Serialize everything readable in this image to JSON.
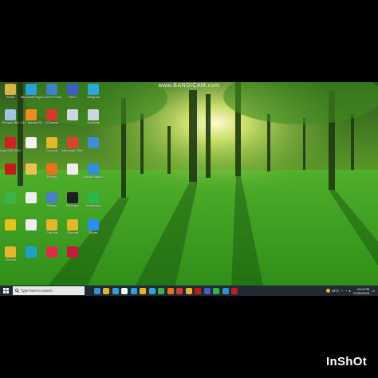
{
  "watermark": "www.BANDICAM.com",
  "desktop_icons": [
    {
      "label": "Home",
      "color": "#d9b24a",
      "icon": "folder-icon"
    },
    {
      "label": "Microsoft Edge",
      "color": "#2f9fd8",
      "icon": "edge-icon"
    },
    {
      "label": "Control Panel",
      "color": "#3f7fc4",
      "icon": "control-panel-icon"
    },
    {
      "label": "Word",
      "color": "#3b5fc4",
      "icon": "word-icon"
    },
    {
      "label": "Telegram",
      "color": "#2ea6da",
      "icon": "telegram-icon"
    },
    {
      "label": "Recycle Bin",
      "color": "#9fc6dd",
      "icon": "recycle-bin-icon"
    },
    {
      "label": "VLC Media Player",
      "color": "#f08c1c",
      "icon": "vlc-icon"
    },
    {
      "label": "CCleaner",
      "color": "#d63a2f",
      "icon": "ccleaner-icon"
    },
    {
      "label": "",
      "color": "#cfd6de",
      "icon": "drive-icon"
    },
    {
      "label": "OneNote",
      "color": "#cfd6de",
      "icon": "app-icon"
    },
    {
      "label": "AutoCAD 2019",
      "color": "#d21f1f",
      "icon": "autocad-icon"
    },
    {
      "label": "",
      "color": "#f2f2f2",
      "icon": "document-icon"
    },
    {
      "label": "Chrome",
      "color": "#e6b52a",
      "icon": "chrome-icon"
    },
    {
      "label": "Microsoft Office",
      "color": "#d9442c",
      "icon": "office-icon"
    },
    {
      "label": "",
      "color": "#3a8fd8",
      "icon": "app-icon"
    },
    {
      "label": "",
      "color": "#c41c1c",
      "icon": "recorder-icon"
    },
    {
      "label": "",
      "color": "#e8c352",
      "icon": "document-icon"
    },
    {
      "label": "Firefox",
      "color": "#e8731c",
      "icon": "firefox-icon"
    },
    {
      "label": "",
      "color": "#eeeeee",
      "icon": "document-icon"
    },
    {
      "label": "Visual Studio Code",
      "color": "#2f8fd8",
      "icon": "vscode-icon"
    },
    {
      "label": "",
      "color": "#3bb54a",
      "icon": "app-icon"
    },
    {
      "label": "",
      "color": "#eeeeee",
      "icon": "document-icon"
    },
    {
      "label": "Python",
      "color": "#4a7fc4",
      "icon": "python-icon"
    },
    {
      "label": "PyCharm",
      "color": "#1f1f1f",
      "icon": "pycharm-icon"
    },
    {
      "label": "WhatsApp",
      "color": "#2bb74a",
      "icon": "whatsapp-icon"
    },
    {
      "label": "",
      "color": "#e8c21c",
      "icon": "app-icon"
    },
    {
      "label": "",
      "color": "#eeeeee",
      "icon": "document-icon"
    },
    {
      "label": "Chrome",
      "color": "#e6b52a",
      "icon": "chrome-icon"
    },
    {
      "label": "Chrome",
      "color": "#e6b52a",
      "icon": "chrome-icon"
    },
    {
      "label": "Zoom",
      "color": "#2d8cf0",
      "icon": "zoom-icon"
    },
    {
      "label": "Chrome",
      "color": "#e6b52a",
      "icon": "chrome-icon"
    },
    {
      "label": "",
      "color": "#1fa0c8",
      "icon": "app-icon"
    },
    {
      "label": "",
      "color": "#e02a4a",
      "icon": "app-icon"
    },
    {
      "label": "",
      "color": "#c41c3a",
      "icon": "app-icon"
    }
  ],
  "taskbar": {
    "search_placeholder": "Type here to search",
    "apps": [
      {
        "color": "#3a8fd8",
        "icon": "task-view-icon"
      },
      {
        "color": "#e6b52a",
        "icon": "file-explorer-icon"
      },
      {
        "color": "#2f9fd8",
        "icon": "edge-icon"
      },
      {
        "color": "#ffffff",
        "icon": "store-icon"
      },
      {
        "color": "#2f9fd8",
        "icon": "mail-icon"
      },
      {
        "color": "#e6b52a",
        "icon": "folder-icon"
      },
      {
        "color": "#2ea6da",
        "icon": "app-icon"
      },
      {
        "color": "#3bb54a",
        "icon": "app-icon"
      },
      {
        "color": "#e8731c",
        "icon": "firefox-icon"
      },
      {
        "color": "#d63a2f",
        "icon": "app-icon"
      },
      {
        "color": "#e6b52a",
        "icon": "chrome-icon"
      },
      {
        "color": "#c41c1c",
        "icon": "app-icon"
      },
      {
        "color": "#3b5fc4",
        "icon": "word-icon"
      },
      {
        "color": "#2bb74a",
        "icon": "whatsapp-icon"
      },
      {
        "color": "#2f8fd8",
        "icon": "vscode-icon"
      },
      {
        "color": "#c41c1c",
        "icon": "recorder-icon"
      }
    ],
    "weather": "33°C",
    "time": "8:14 PM",
    "date": "07/02/2024"
  },
  "inshot_watermark": "InShOt"
}
